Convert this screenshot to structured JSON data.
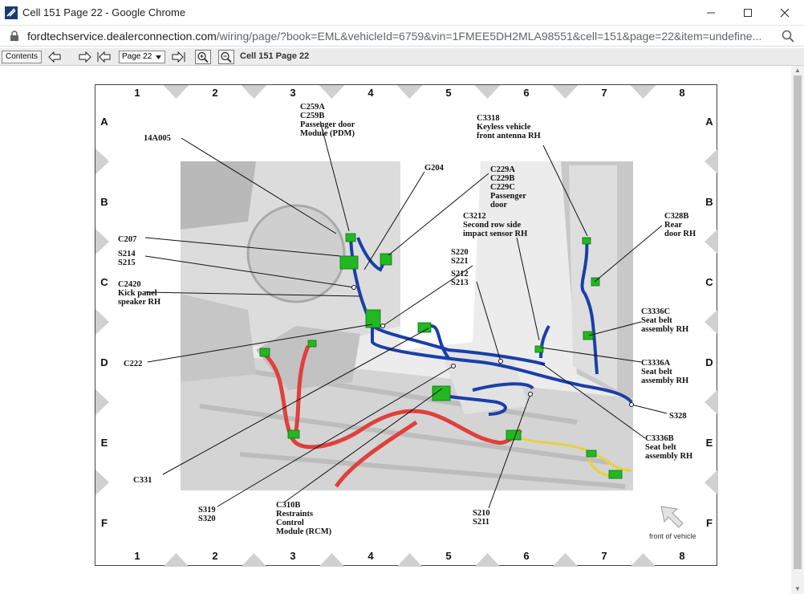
{
  "window": {
    "title": "Cell 151 Page 22 - Google Chrome"
  },
  "address": {
    "host": "fordtechservice.dealerconnection.com",
    "path": "/wiring/page/?book=EML&vehicleId=6759&vin=1FMEE5DH2MLA98551&cell=151&page=22&item=undefine..."
  },
  "toolbar": {
    "contents_label": "Contents",
    "page_select": "Page 22",
    "page_title": "Cell 151 Page 22"
  },
  "diagram": {
    "columns": [
      "1",
      "2",
      "3",
      "4",
      "5",
      "6",
      "7",
      "8"
    ],
    "rows": [
      "A",
      "B",
      "C",
      "D",
      "E",
      "F"
    ],
    "front_of_vehicle": "front of vehicle",
    "labels": {
      "c259": [
        "C259A",
        "C259B",
        "Passenger door",
        "Module (PDM)"
      ],
      "a14005": [
        "14A005"
      ],
      "g204": [
        "G204"
      ],
      "c229": [
        "C229A",
        "C229B",
        "C229C",
        "Passenger",
        "door"
      ],
      "c3318": [
        "C3318",
        "Keyless vehicle",
        "front antenna RH"
      ],
      "c3212": [
        "C3212",
        "Second row side",
        "impact sensor RH"
      ],
      "c328b": [
        "C328B",
        "Rear",
        "door RH"
      ],
      "c207": [
        "C207"
      ],
      "s214": [
        "S214",
        "S215"
      ],
      "s220": [
        "S220",
        "S221"
      ],
      "s212": [
        "S212",
        "S213"
      ],
      "c2420": [
        "C2420",
        "Kick panel",
        "speaker RH"
      ],
      "c3336c": [
        "C3336C",
        "Seat belt",
        "assembly RH"
      ],
      "c222": [
        "C222"
      ],
      "c3336a": [
        "C3336A",
        "Seat belt",
        "assembly RH"
      ],
      "s328": [
        "S328"
      ],
      "c3336b": [
        "C3336B",
        "Seat belt",
        "assembly RH"
      ],
      "c331": [
        "C331"
      ],
      "s319": [
        "S319",
        "S320"
      ],
      "c310b": [
        "C310B",
        "Restraints",
        "Control",
        "Module (RCM)"
      ],
      "s210": [
        "S210",
        "S211"
      ]
    }
  },
  "colors": {
    "harness_blue": "#1a3fa8",
    "harness_red": "#e0403c",
    "harness_yellow": "#e8d23a",
    "connector_green": "#22b822"
  }
}
